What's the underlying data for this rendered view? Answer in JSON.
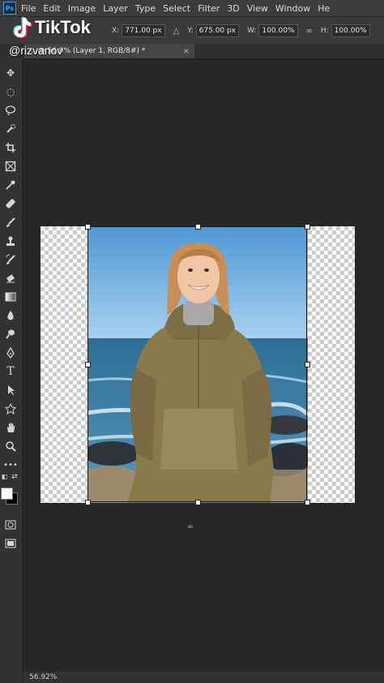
{
  "app": {
    "logo": "Ps",
    "menu": [
      "File",
      "Edit",
      "Image",
      "Layer",
      "Type",
      "Select",
      "Filter",
      "3D",
      "View",
      "Window",
      "He"
    ]
  },
  "options_bar": {
    "x_label": "X:",
    "x_value": "771.00 px",
    "y_label": "Y:",
    "y_value": "675.00 px",
    "w_label": "W:",
    "w_value": "100.00%",
    "h_label": "H:",
    "h_value": "100.00%",
    "delta_icon": "triangle-icon",
    "link_icon": "link-icon"
  },
  "document_tab": {
    "title": "...@ 56.9% (Layer 1, RGB/8#) *",
    "close": "×"
  },
  "status_bar": {
    "zoom": "56.92%"
  },
  "overlay": {
    "brand": "TikTok",
    "handle": "@rizvanov"
  },
  "colors": {
    "sky_top": "#4f97d6",
    "sky_bottom": "#9cc9ea",
    "sea": "#3f7ea6",
    "jacket": "#8a7a4a",
    "hair": "#c98e55"
  }
}
